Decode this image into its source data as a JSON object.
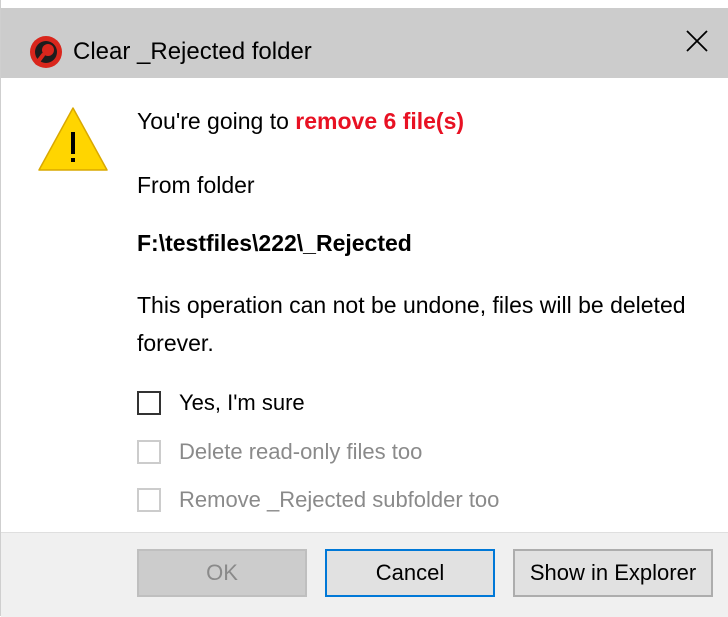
{
  "window": {
    "title": "Clear _Rejected folder",
    "app_icon": "app-logo-icon",
    "close_icon": "close-icon"
  },
  "message": {
    "warning_icon": "warning-triangle-icon",
    "headline_prefix": "You're going to ",
    "headline_highlight": "remove 6 file(s)",
    "from_label": "From folder",
    "folder_path": "F:\\testfiles\\222\\_Rejected",
    "warning_text": "This operation can not be undone, files will be deleted forever."
  },
  "options": [
    {
      "label": "Yes, I'm sure",
      "checked": false,
      "enabled": true
    },
    {
      "label": "Delete read-only files too",
      "checked": false,
      "enabled": false
    },
    {
      "label": "Remove _Rejected subfolder too",
      "checked": false,
      "enabled": false
    }
  ],
  "buttons": {
    "ok": "OK",
    "cancel": "Cancel",
    "show_in_explorer": "Show in Explorer"
  },
  "colors": {
    "highlight": "#e81123",
    "warning_fill": "#ffd500",
    "focus_border": "#0078d7"
  }
}
